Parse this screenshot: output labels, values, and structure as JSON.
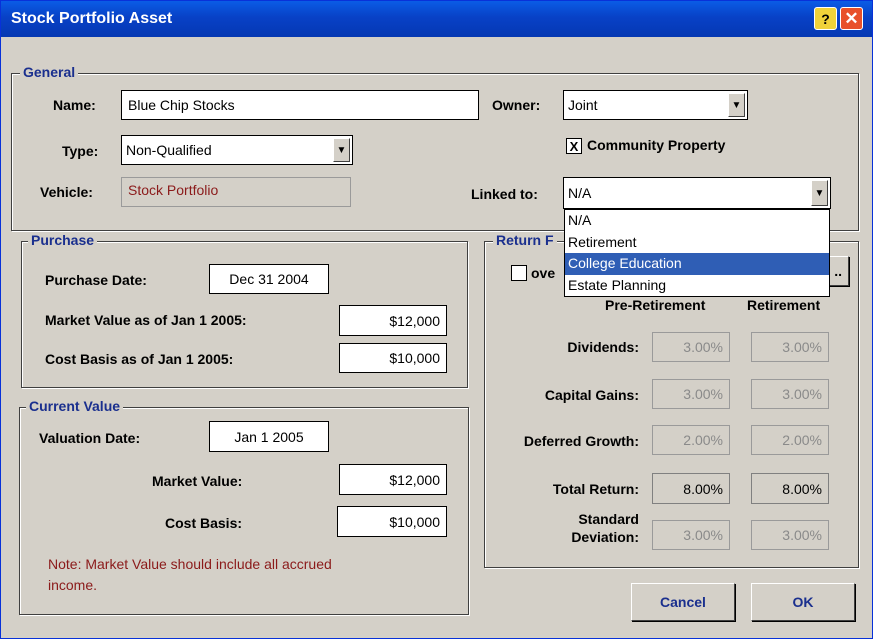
{
  "window": {
    "title": "Stock Portfolio Asset",
    "help": "?",
    "close": "✕"
  },
  "general": {
    "legend": "General",
    "name_label": "Name:",
    "name_value": "Blue Chip Stocks",
    "type_label": "Type:",
    "type_value": "Non-Qualified",
    "vehicle_label": "Vehicle:",
    "vehicle_value": "Stock Portfolio",
    "owner_label": "Owner:",
    "owner_value": "Joint",
    "community_property_label": "Community Property",
    "community_property_checked": "X",
    "linked_label": "Linked to:",
    "linked_value": "N/A",
    "linked_options": [
      "N/A",
      "Retirement",
      "College Education",
      "Estate Planning"
    ],
    "linked_selected_index": 2
  },
  "purchase": {
    "legend": "Purchase",
    "date_label": "Purchase Date:",
    "date_value": "Dec 31 2004",
    "market_label": "Market Value as of Jan 1 2005:",
    "market_value": "$12,000",
    "cost_label": "Cost Basis as of Jan 1 2005:",
    "cost_value": "$10,000"
  },
  "current": {
    "legend": "Current Value",
    "date_label": "Valuation Date:",
    "date_value": "Jan 1 2005",
    "market_label": "Market Value:",
    "market_value": "$12,000",
    "cost_label": "Cost Basis:",
    "cost_value": "$10,000",
    "note": "Note: Market Value should include all accrued income."
  },
  "returns": {
    "legend": "Return F",
    "override_label": "ove",
    "button_label": "..",
    "col_pre": "Pre-Retirement",
    "col_ret": "Retirement",
    "rows": [
      {
        "label": "Dividends:",
        "pre": "3.00%",
        "ret": "3.00%"
      },
      {
        "label": "Capital Gains:",
        "pre": "3.00%",
        "ret": "3.00%"
      },
      {
        "label": "Deferred Growth:",
        "pre": "2.00%",
        "ret": "2.00%"
      },
      {
        "label": "Total Return:",
        "pre": "8.00%",
        "ret": "8.00%"
      }
    ],
    "std_label_line1": "Standard",
    "std_label_line2": "Deviation:",
    "std_pre": "3.00%",
    "std_ret": "3.00%"
  },
  "buttons": {
    "cancel": "Cancel",
    "ok": "OK"
  },
  "colors": {
    "title_bar": "#0841c6",
    "legend_text": "#1a2f8e",
    "note_text": "#8b1a1a",
    "selection": "#2f5eb5"
  }
}
